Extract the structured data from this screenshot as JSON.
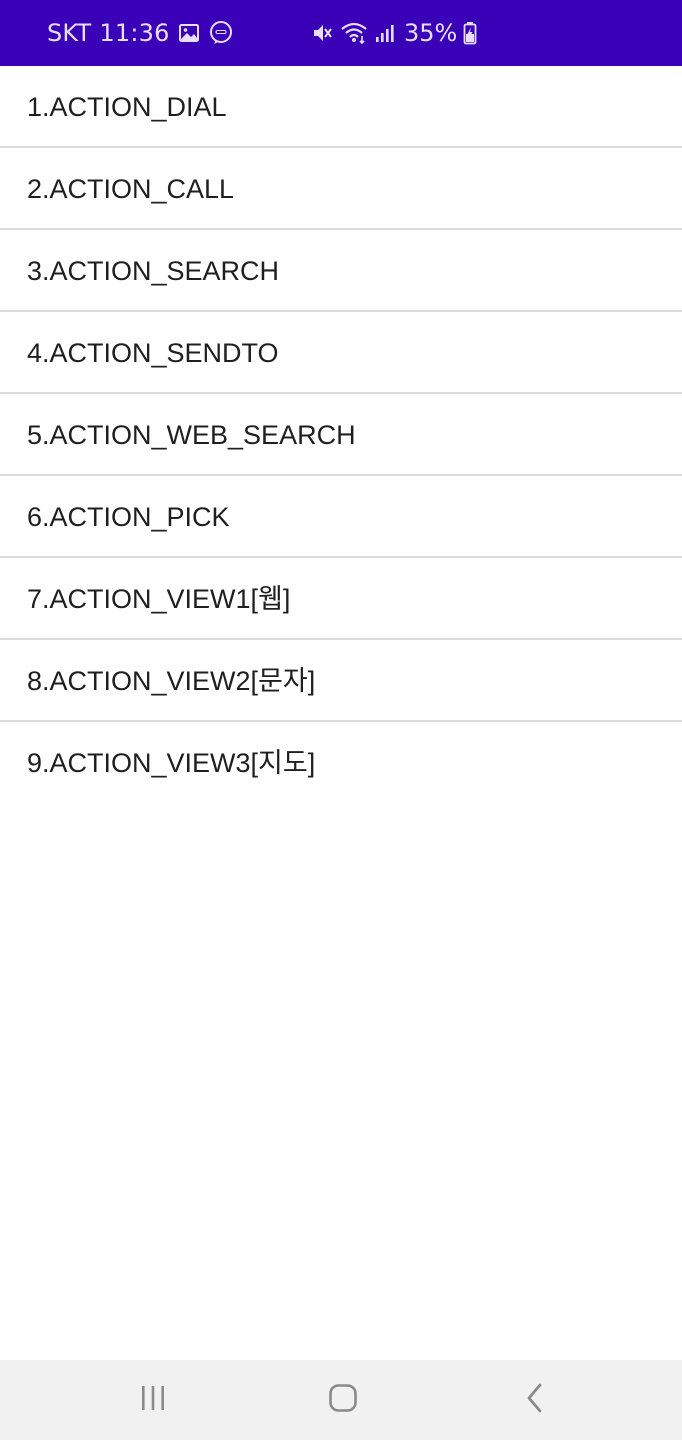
{
  "status_bar": {
    "carrier": "SKT",
    "time": "11:36",
    "battery_percent": "35%",
    "icons": [
      "image-icon",
      "chat-icon",
      "mute-icon",
      "wifi-icon",
      "signal-icon",
      "battery-charging-icon"
    ],
    "background_color": "#3a00b8"
  },
  "list": {
    "items": [
      {
        "label": "1.ACTION_DIAL"
      },
      {
        "label": "2.ACTION_CALL"
      },
      {
        "label": "3.ACTION_SEARCH"
      },
      {
        "label": "4.ACTION_SENDTO"
      },
      {
        "label": "5.ACTION_WEB_SEARCH"
      },
      {
        "label": "6.ACTION_PICK"
      },
      {
        "label": "7.ACTION_VIEW1[웹]"
      },
      {
        "label": "8.ACTION_VIEW2[문자]"
      },
      {
        "label": "9.ACTION_VIEW3[지도]"
      }
    ]
  },
  "nav_bar": {
    "buttons": [
      "recents-icon",
      "home-icon",
      "back-icon"
    ]
  }
}
